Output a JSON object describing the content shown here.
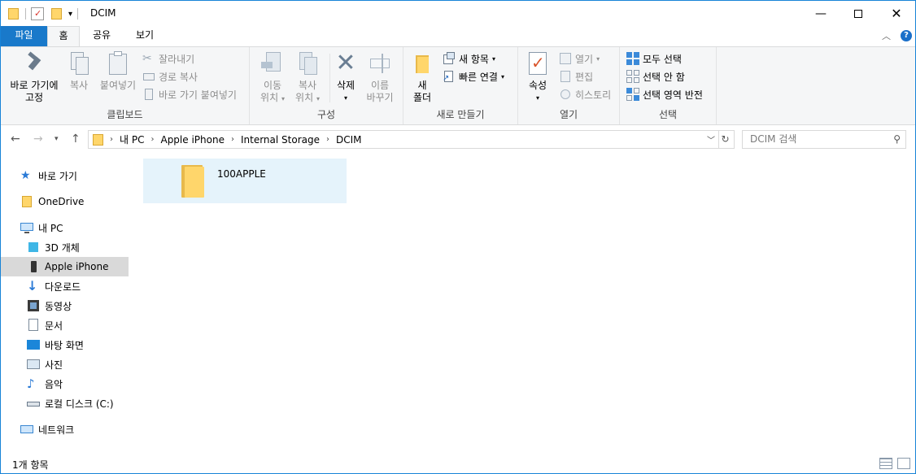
{
  "title": "DCIM",
  "tabs": {
    "file": "파일",
    "home": "홈",
    "share": "공유",
    "view": "보기"
  },
  "ribbon": {
    "clipboard": {
      "label": "클립보드",
      "pin_line1": "바로 가기에",
      "pin_line2": "고정",
      "copy": "복사",
      "paste": "붙여넣기",
      "cut": "잘라내기",
      "copy_path": "경로 복사",
      "paste_shortcut": "바로 가기 붙여넣기"
    },
    "organize": {
      "label": "구성",
      "move_line1": "이동",
      "move_line2": "위치",
      "copyto_line1": "복사",
      "copyto_line2": "위치",
      "delete": "삭제",
      "rename_line1": "이름",
      "rename_line2": "바꾸기"
    },
    "new": {
      "label": "새로 만들기",
      "folder_line1": "새",
      "folder_line2": "폴더",
      "new_item": "새 항목",
      "easy_access": "빠른 연결"
    },
    "open": {
      "label": "열기",
      "properties": "속성",
      "open": "열기",
      "edit": "편집",
      "history": "히스토리"
    },
    "select": {
      "label": "선택",
      "select_all": "모두 선택",
      "select_none": "선택 안 함",
      "invert": "선택 영역 반전"
    }
  },
  "address": {
    "crumbs": [
      "내 PC",
      "Apple iPhone",
      "Internal Storage",
      "DCIM"
    ],
    "search_placeholder": "DCIM 검색"
  },
  "nav": {
    "quick_access": "바로 가기",
    "onedrive": "OneDrive",
    "this_pc": "내 PC",
    "objects3d": "3D 개체",
    "iphone": "Apple iPhone",
    "downloads": "다운로드",
    "videos": "동영상",
    "documents": "문서",
    "desktop": "바탕 화면",
    "pictures": "사진",
    "music": "음악",
    "local_disk": "로컬 디스크 (C:)",
    "network": "네트워크"
  },
  "files": [
    {
      "name": "100APPLE"
    }
  ],
  "status": {
    "count": "1개 항목"
  },
  "colors": {
    "accent": "#1979ca",
    "selection": "#e5f3fb",
    "nav_selected": "#d9d9d9"
  }
}
